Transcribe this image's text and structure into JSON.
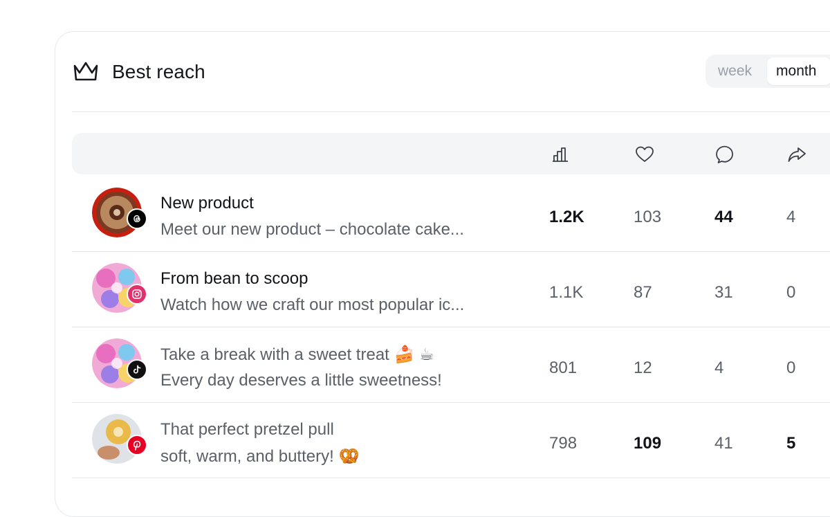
{
  "header": {
    "title": "Best reach",
    "crown_icon": "crown-icon"
  },
  "period": {
    "options": [
      "week",
      "month"
    ],
    "selected": "month"
  },
  "columns": {
    "icons": [
      "bar-chart-icon",
      "heart-icon",
      "comment-icon",
      "share-icon"
    ]
  },
  "rows": [
    {
      "title": "New product",
      "subtitle": "Meet our new product – chocolate cake...",
      "platform": "threads",
      "reach": "1.2K",
      "likes": "103",
      "comments": "44",
      "shares": "4"
    },
    {
      "title": "From bean to scoop",
      "subtitle": "Watch how we craft our most popular ic...",
      "platform": "instagram",
      "reach": "1.1K",
      "likes": "87",
      "comments": "31",
      "shares": "0"
    },
    {
      "title": "Take a break with a sweet treat 🍰 ☕",
      "subtitle": "Every day deserves a little sweetness!",
      "platform": "tiktok",
      "reach": "801",
      "likes": "12",
      "comments": "4",
      "shares": "0"
    },
    {
      "title": "That perfect pretzel pull",
      "subtitle": "soft, warm, and buttery! 🥨",
      "platform": "pinterest",
      "reach": "798",
      "likes": "109",
      "comments": "41",
      "shares": "5"
    }
  ],
  "colors": {
    "instagram": "#e1306c",
    "pinterest": "#e60023",
    "threads": "#000000",
    "tiktok": "#111111"
  }
}
